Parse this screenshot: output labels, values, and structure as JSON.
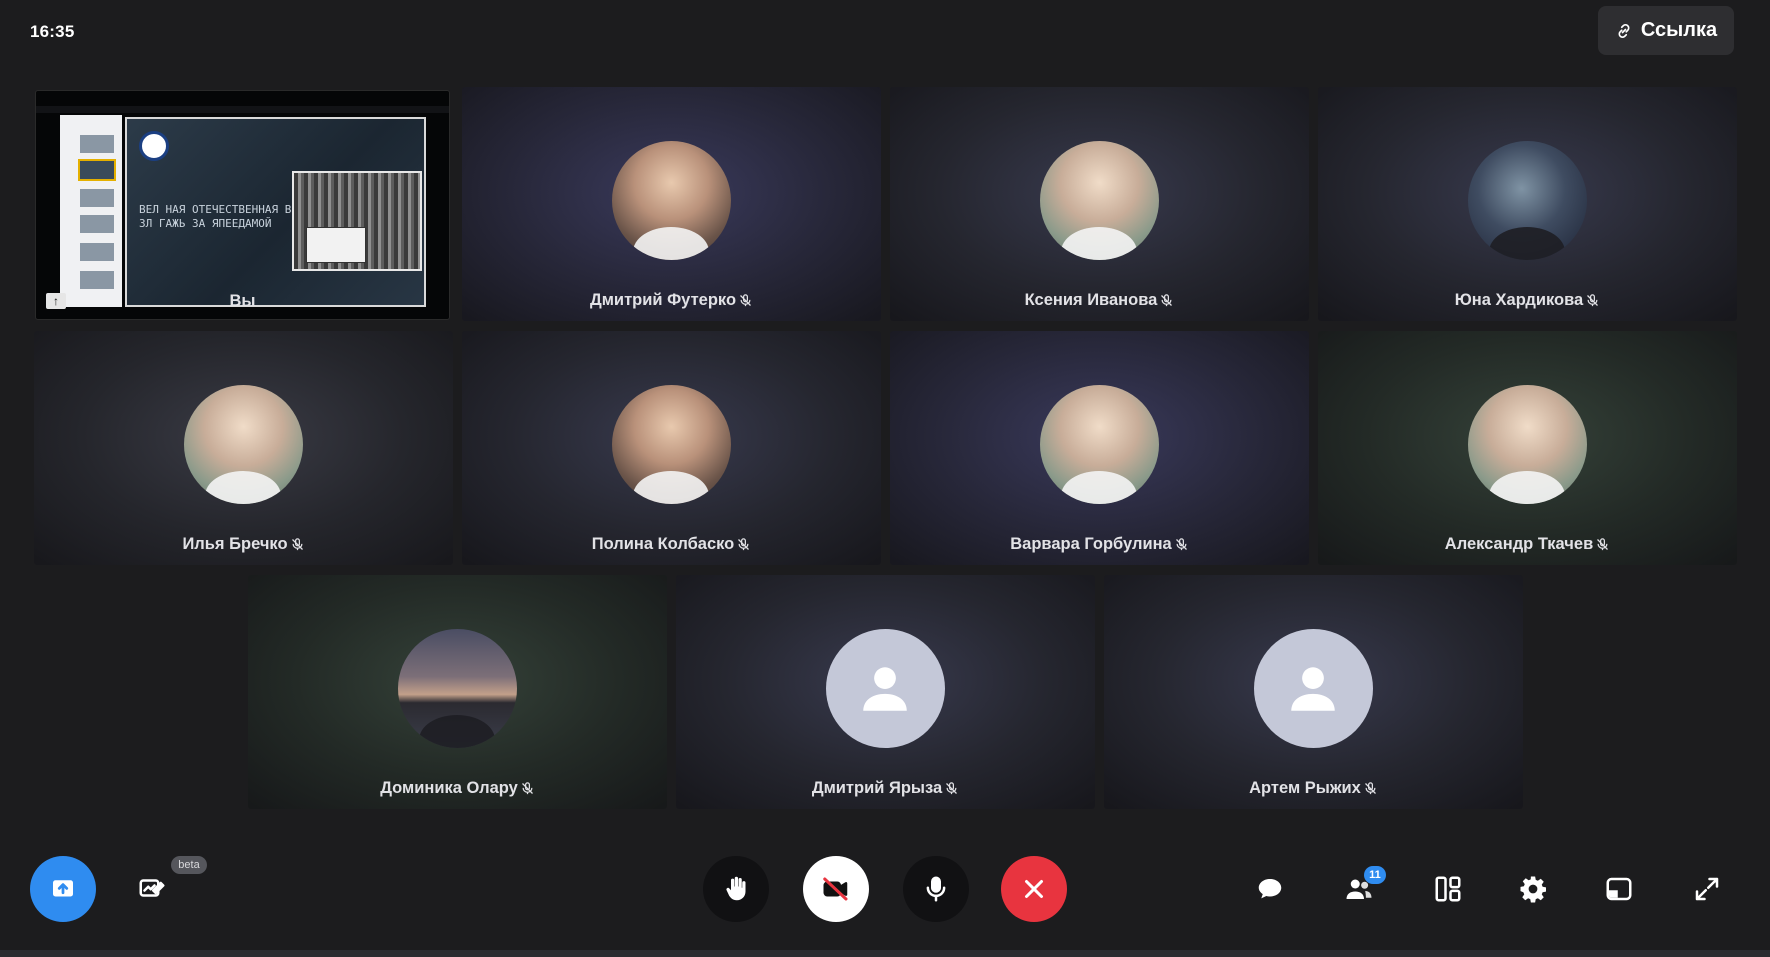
{
  "header": {
    "clock": "16:35",
    "link_label": "Ссылка"
  },
  "self_tile": {
    "label": "Вы"
  },
  "participants": [
    {
      "name": "Дмитрий Футерко"
    },
    {
      "name": "Ксения Иванова"
    },
    {
      "name": "Юна Хардикова"
    },
    {
      "name": "Илья Бречко"
    },
    {
      "name": "Полина Колбаско"
    },
    {
      "name": "Варвара Горбулина"
    },
    {
      "name": "Александр Ткачев"
    },
    {
      "name": "Доминика Олару"
    },
    {
      "name": "Дмитрий Ярыза"
    },
    {
      "name": "Артем Рыжих"
    }
  ],
  "screen_share": {
    "slide_text_line1": "ВЕЛ НАЯ ОТЕЧЕСТВЕННАЯ ВОЙНА",
    "slide_text_line2": "ЗЛ ГАЖЬ ЗА ЯПЕЕДАМОЙ"
  },
  "toolbar": {
    "beta_label": "beta",
    "participants_count": "11"
  },
  "colors": {
    "background": "#1c1c1e",
    "accent_blue": "#2f8cf0",
    "end_call_red": "#e8343f",
    "control_dark": "#111113"
  },
  "icons": [
    "link-icon",
    "mic-off-icon",
    "user-placeholder-icon",
    "share-screen-icon",
    "whiteboard-icon",
    "raise-hand-icon",
    "camera-off-icon",
    "microphone-icon",
    "end-call-icon",
    "chat-icon",
    "participants-icon",
    "layout-icon",
    "settings-icon",
    "pip-icon",
    "fullscreen-icon"
  ]
}
